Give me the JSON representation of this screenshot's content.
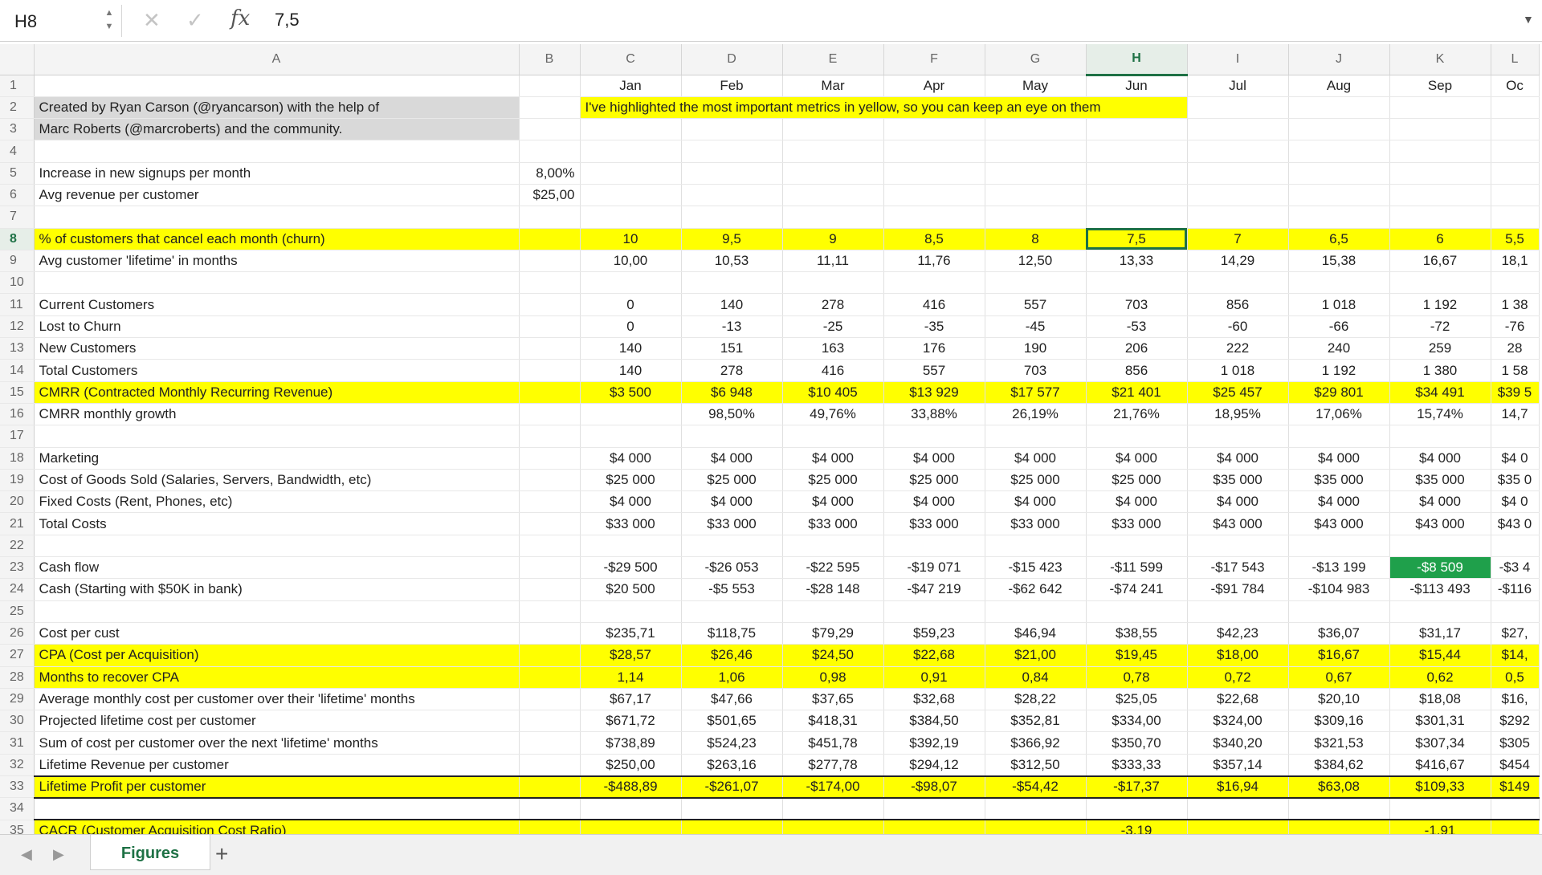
{
  "formula_bar": {
    "cell_ref": "H8",
    "cancel_glyph": "✕",
    "confirm_glyph": "✓",
    "fx_label": "fx",
    "value": "7,5"
  },
  "columns": [
    "A",
    "B",
    "C",
    "D",
    "E",
    "F",
    "G",
    "H",
    "I",
    "J",
    "K",
    "L"
  ],
  "selected_column": "H",
  "rows": [
    {
      "n": "1",
      "a": "",
      "b": "",
      "v": [
        "Jan",
        "Feb",
        "Mar",
        "Apr",
        "May",
        "Jun",
        "Jul",
        "Aug",
        "Sep",
        "Oc"
      ]
    },
    {
      "n": "2",
      "a": "Created by Ryan Carson (@ryancarson) with the help of",
      "b": "",
      "banner": "I've highlighted the most important metrics in yellow, so you can keep an eye on them"
    },
    {
      "n": "3",
      "a": "Marc Roberts (@marcroberts) and the community.",
      "b": "",
      "v": []
    },
    {
      "n": "4",
      "a": "",
      "b": "",
      "v": []
    },
    {
      "n": "5",
      "a": "Increase in new signups per month",
      "b": "8,00%",
      "v": []
    },
    {
      "n": "6",
      "a": "Avg revenue per customer",
      "b": "$25,00",
      "v": []
    },
    {
      "n": "7",
      "a": "",
      "b": "",
      "v": []
    },
    {
      "n": "8",
      "a": "% of customers that cancel each month (churn)",
      "b": "",
      "v": [
        "10",
        "9,5",
        "9",
        "8,5",
        "8",
        "7,5",
        "7",
        "6,5",
        "6",
        "5,5"
      ]
    },
    {
      "n": "9",
      "a": "Avg customer 'lifetime' in months",
      "b": "",
      "v": [
        "10,00",
        "10,53",
        "11,11",
        "11,76",
        "12,50",
        "13,33",
        "14,29",
        "15,38",
        "16,67",
        "18,1"
      ]
    },
    {
      "n": "10",
      "a": "",
      "b": "",
      "v": []
    },
    {
      "n": "11",
      "a": "Current Customers",
      "b": "",
      "v": [
        "0",
        "140",
        "278",
        "416",
        "557",
        "703",
        "856",
        "1 018",
        "1 192",
        "1 38"
      ]
    },
    {
      "n": "12",
      "a": "Lost to Churn",
      "b": "",
      "v": [
        "0",
        "-13",
        "-25",
        "-35",
        "-45",
        "-53",
        "-60",
        "-66",
        "-72",
        "-76"
      ]
    },
    {
      "n": "13",
      "a": "New Customers",
      "b": "",
      "v": [
        "140",
        "151",
        "163",
        "176",
        "190",
        "206",
        "222",
        "240",
        "259",
        "28"
      ]
    },
    {
      "n": "14",
      "a": "Total Customers",
      "b": "",
      "v": [
        "140",
        "278",
        "416",
        "557",
        "703",
        "856",
        "1 018",
        "1 192",
        "1 380",
        "1 58"
      ]
    },
    {
      "n": "15",
      "a": "CMRR (Contracted Monthly Recurring Revenue)",
      "b": "",
      "v": [
        "$3 500",
        "$6 948",
        "$10 405",
        "$13 929",
        "$17 577",
        "$21 401",
        "$25 457",
        "$29 801",
        "$34 491",
        "$39 5"
      ]
    },
    {
      "n": "16",
      "a": "CMRR monthly growth",
      "b": "",
      "v": [
        "",
        "98,50%",
        "49,76%",
        "33,88%",
        "26,19%",
        "21,76%",
        "18,95%",
        "17,06%",
        "15,74%",
        "14,7"
      ]
    },
    {
      "n": "17",
      "a": "",
      "b": "",
      "v": []
    },
    {
      "n": "18",
      "a": "Marketing",
      "b": "",
      "v": [
        "$4 000",
        "$4 000",
        "$4 000",
        "$4 000",
        "$4 000",
        "$4 000",
        "$4 000",
        "$4 000",
        "$4 000",
        "$4 0"
      ]
    },
    {
      "n": "19",
      "a": "Cost of Goods Sold (Salaries, Servers, Bandwidth, etc)",
      "b": "",
      "v": [
        "$25 000",
        "$25 000",
        "$25 000",
        "$25 000",
        "$25 000",
        "$25 000",
        "$35 000",
        "$35 000",
        "$35 000",
        "$35 0"
      ]
    },
    {
      "n": "20",
      "a": "Fixed Costs (Rent, Phones, etc)",
      "b": "",
      "v": [
        "$4 000",
        "$4 000",
        "$4 000",
        "$4 000",
        "$4 000",
        "$4 000",
        "$4 000",
        "$4 000",
        "$4 000",
        "$4 0"
      ]
    },
    {
      "n": "21",
      "a": "Total Costs",
      "b": "",
      "v": [
        "$33 000",
        "$33 000",
        "$33 000",
        "$33 000",
        "$33 000",
        "$33 000",
        "$43 000",
        "$43 000",
        "$43 000",
        "$43 0"
      ]
    },
    {
      "n": "22",
      "a": "",
      "b": "",
      "v": []
    },
    {
      "n": "23",
      "a": "Cash flow",
      "b": "",
      "v": [
        "-$29 500",
        "-$26 053",
        "-$22 595",
        "-$19 071",
        "-$15 423",
        "-$11 599",
        "-$17 543",
        "-$13 199",
        "-$8 509",
        "-$3 4"
      ]
    },
    {
      "n": "24",
      "a": "Cash (Starting with $50K in bank)",
      "b": "",
      "v": [
        "$20 500",
        "-$5 553",
        "-$28 148",
        "-$47 219",
        "-$62 642",
        "-$74 241",
        "-$91 784",
        "-$104 983",
        "-$113 493",
        "-$116"
      ]
    },
    {
      "n": "25",
      "a": "",
      "b": "",
      "v": []
    },
    {
      "n": "26",
      "a": "Cost per cust",
      "b": "",
      "v": [
        "$235,71",
        "$118,75",
        "$79,29",
        "$59,23",
        "$46,94",
        "$38,55",
        "$42,23",
        "$36,07",
        "$31,17",
        "$27,"
      ]
    },
    {
      "n": "27",
      "a": "CPA (Cost per Acquisition)",
      "b": "",
      "v": [
        "$28,57",
        "$26,46",
        "$24,50",
        "$22,68",
        "$21,00",
        "$19,45",
        "$18,00",
        "$16,67",
        "$15,44",
        "$14,"
      ]
    },
    {
      "n": "28",
      "a": "Months to recover CPA",
      "b": "",
      "v": [
        "1,14",
        "1,06",
        "0,98",
        "0,91",
        "0,84",
        "0,78",
        "0,72",
        "0,67",
        "0,62",
        "0,5"
      ]
    },
    {
      "n": "29",
      "a": "Average monthly cost per customer over their 'lifetime' months",
      "b": "",
      "v": [
        "$67,17",
        "$47,66",
        "$37,65",
        "$32,68",
        "$28,22",
        "$25,05",
        "$22,68",
        "$20,10",
        "$18,08",
        "$16,"
      ]
    },
    {
      "n": "30",
      "a": "Projected lifetime cost per customer",
      "b": "",
      "v": [
        "$671,72",
        "$501,65",
        "$418,31",
        "$384,50",
        "$352,81",
        "$334,00",
        "$324,00",
        "$309,16",
        "$301,31",
        "$292"
      ]
    },
    {
      "n": "31",
      "a": "Sum of cost per customer over the next 'lifetime' months",
      "b": "",
      "v": [
        "$738,89",
        "$524,23",
        "$451,78",
        "$392,19",
        "$366,92",
        "$350,70",
        "$340,20",
        "$321,53",
        "$307,34",
        "$305"
      ]
    },
    {
      "n": "32",
      "a": "Lifetime Revenue per customer",
      "b": "",
      "v": [
        "$250,00",
        "$263,16",
        "$277,78",
        "$294,12",
        "$312,50",
        "$333,33",
        "$357,14",
        "$384,62",
        "$416,67",
        "$454"
      ]
    },
    {
      "n": "33",
      "a": "Lifetime Profit per customer",
      "b": "",
      "v": [
        "-$488,89",
        "-$261,07",
        "-$174,00",
        "-$98,07",
        "-$54,42",
        "-$17,37",
        "$16,94",
        "$63,08",
        "$109,33",
        "$149"
      ]
    },
    {
      "n": "34",
      "a": "",
      "b": "",
      "v": []
    },
    {
      "n": "35",
      "a": "CACR (Customer Acquisition Cost Ratio)",
      "b": "",
      "v": [
        "",
        "",
        "",
        "",
        "",
        "-3,19",
        "",
        "",
        "-1,91",
        ""
      ]
    }
  ],
  "sheet_tabs": {
    "prev_glyph": "◀",
    "next_glyph": "▶",
    "active_tab": "Figures",
    "add_glyph": "+"
  }
}
